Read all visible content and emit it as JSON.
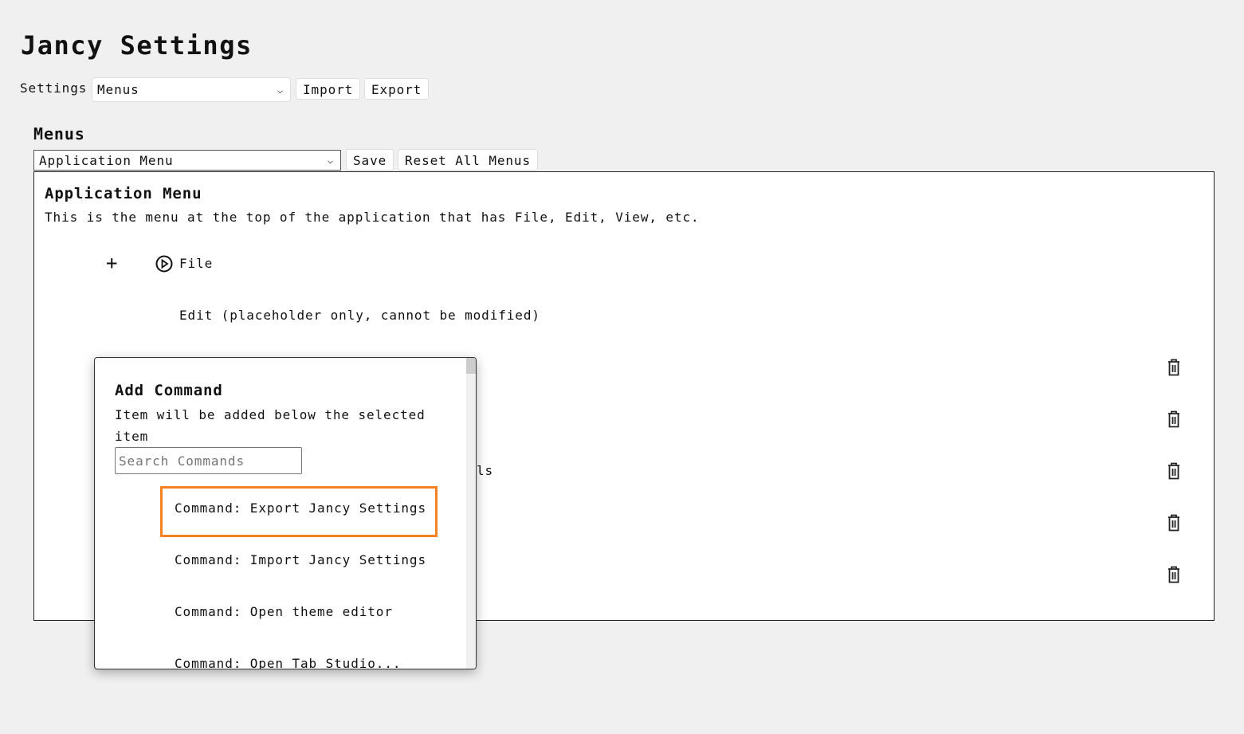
{
  "title": "Jancy Settings",
  "settings_label": "Settings",
  "settings_select": "Menus",
  "import_label": "Import",
  "export_label": "Export",
  "section_title": "Menus",
  "menu_select": "Application Menu",
  "save_label": "Save",
  "reset_label": "Reset All Menus",
  "panel": {
    "title": "Application Menu",
    "description": "This is the menu at the top of the application that has File, Edit, View, etc.",
    "items": [
      {
        "label": "File"
      },
      {
        "label": "Edit (placeholder only, cannot be modified)"
      }
    ],
    "partial_text": "ls"
  },
  "popup": {
    "title": "Add Command",
    "description": "Item will be added below the selected item",
    "search_placeholder": "Search Commands",
    "commands": [
      "Command: Export Jancy Settings",
      "Command: Import Jancy Settings",
      "Command: Open theme editor",
      "Command: Open Tab Studio..."
    ],
    "highlight_color": "#f58220"
  }
}
